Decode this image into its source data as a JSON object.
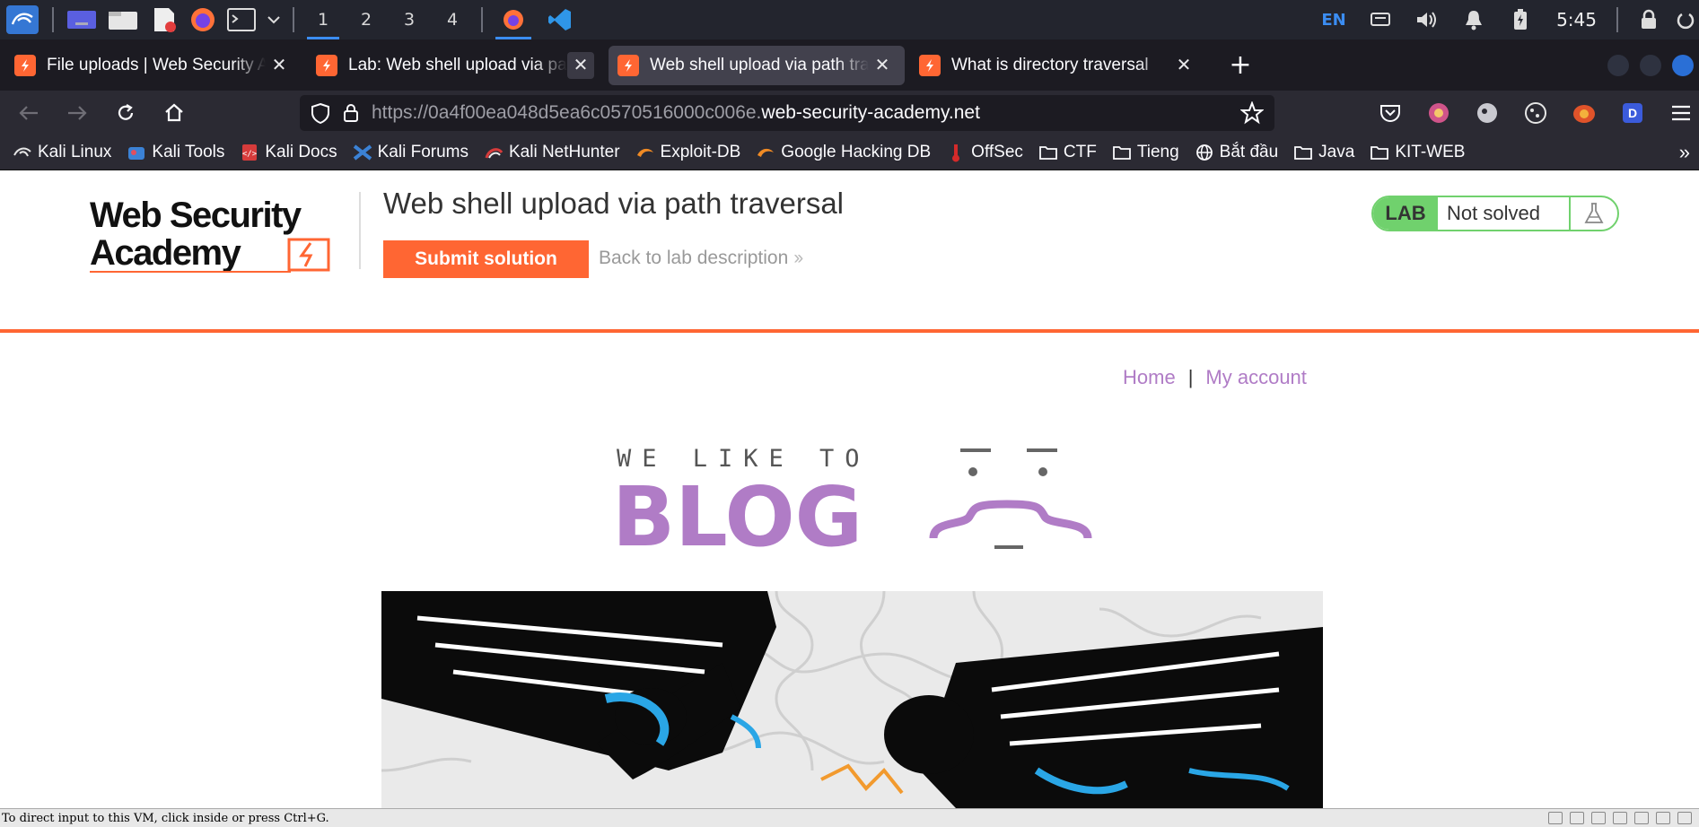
{
  "panel": {
    "workspaces": [
      "1",
      "2",
      "3",
      "4"
    ],
    "active_workspace": "1",
    "language": "EN",
    "clock": "5:45"
  },
  "tabs": [
    {
      "label": "File uploads | Web Security Academy",
      "active": false
    },
    {
      "label": "Lab: Web shell upload via path traversal",
      "active": false
    },
    {
      "label": "Web shell upload via path traversal",
      "active": true
    },
    {
      "label": "What is directory traversal",
      "active": false
    }
  ],
  "urlbar": {
    "prefix": "https://0a4f00ea048d5ea6c0570516000c006e.",
    "host": "web-security-academy.net"
  },
  "bookmarks": [
    "Kali Linux",
    "Kali Tools",
    "Kali Docs",
    "Kali Forums",
    "Kali NetHunter",
    "Exploit-DB",
    "Google Hacking DB",
    "OffSec",
    "CTF",
    "Tieng",
    "Bắt đầu",
    "Java",
    "KIT-WEB"
  ],
  "academy": {
    "logo_line1": "Web Security",
    "logo_line2": "Academy",
    "lab_title": "Web shell upload via path traversal",
    "submit_label": "Submit solution",
    "back_label": "Back to lab description",
    "badge_lab": "LAB",
    "badge_status": "Not solved"
  },
  "nav": {
    "home": "Home",
    "separator": "|",
    "account": "My account"
  },
  "blog": {
    "tagline": "WE LIKE TO",
    "word": "BLOG"
  },
  "vm_status": "To direct input to this VM, click inside or press Ctrl+G.",
  "colors": {
    "accent": "#ff6633",
    "lab_green": "#70d16d",
    "blog_purple": "#b07cc6"
  }
}
